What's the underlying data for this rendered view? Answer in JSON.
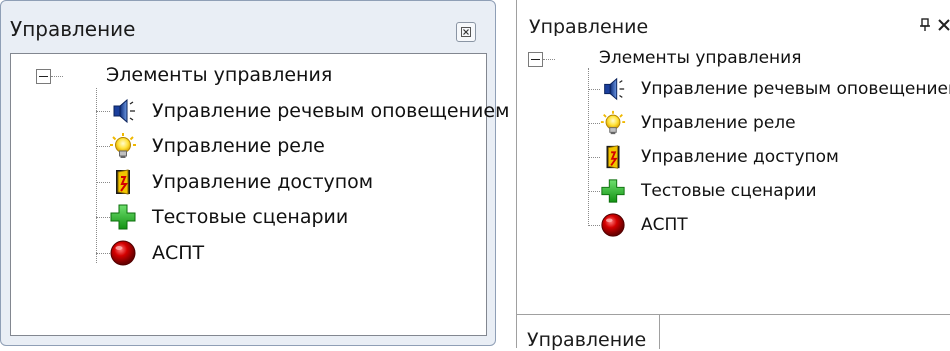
{
  "left_panel": {
    "title": "Управление",
    "tree": {
      "root_label": "Элементы управления",
      "items": [
        {
          "label": "Управление речевым оповещением",
          "icon": "speaker-icon"
        },
        {
          "label": "Управление реле",
          "icon": "lightbulb-icon"
        },
        {
          "label": "Управление доступом",
          "icon": "door-icon"
        },
        {
          "label": "Тестовые сценарии",
          "icon": "green-plus-icon"
        },
        {
          "label": "АСПТ",
          "icon": "red-lamp-icon"
        }
      ]
    }
  },
  "right_panel": {
    "title": "Управление",
    "pin_glyph": "ᵖ",
    "close_glyph": "×",
    "tree": {
      "root_label": "Элементы управления",
      "items": [
        {
          "label": "Управление речевым оповещением",
          "icon": "speaker-icon"
        },
        {
          "label": "Управление реле",
          "icon": "lightbulb-icon"
        },
        {
          "label": "Управление доступом",
          "icon": "door-icon"
        },
        {
          "label": "Тестовые сценарии",
          "icon": "green-plus-icon"
        },
        {
          "label": "АСПТ",
          "icon": "red-lamp-icon"
        }
      ]
    },
    "tab_label": "Управление"
  },
  "colors": {
    "window_bg": "#e9eef5",
    "window_border": "#8f9fb6",
    "plus_green": "#2db52d",
    "lamp_red": "#cc0000",
    "bulb_yellow": "#ffd400"
  }
}
